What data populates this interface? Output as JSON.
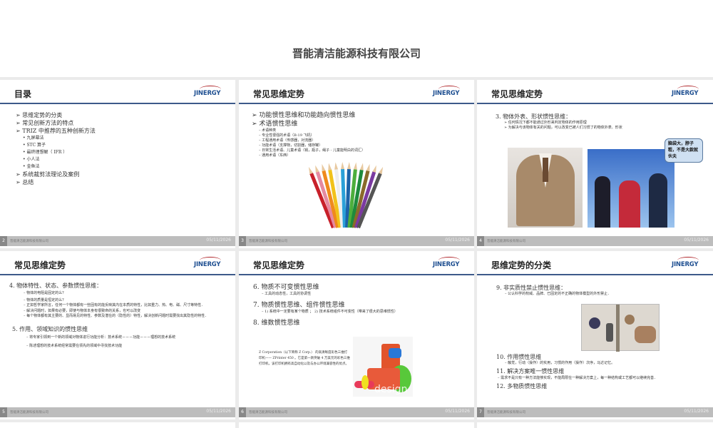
{
  "document_title": "晋能清洁能源科技有限公司",
  "logo_text": "JINERGY",
  "footer_company": "晋能清洁能源科技有限公司",
  "footer_date": "05/11/2026",
  "slides": [
    {
      "number": "2",
      "title": "目录",
      "items": [
        "➢ 思维定势的分类",
        "➢ 常见创新方法的特点",
        "➢ TRIZ 中推荐的五种创新方法"
      ],
      "subitems": [
        "•  九屏幕法",
        "•  STC 算子",
        "•  最终理想解（ IFR ）",
        "•  小人法",
        "•  金鱼法"
      ],
      "items2": [
        "➢ 系统裁剪法理论及案例",
        "➢ 总结"
      ]
    },
    {
      "number": "3",
      "title": "常见思维定势",
      "items": [
        "➢ 功能惯性思维和功能趋向惯性思维",
        "➢ 术语惯性思维"
      ],
      "subitems": [
        "–  术语种类",
        "–  专业性很强的术语（B-19 飞机）",
        "–  工程通用术语（传感器，对流器）",
        "–  功能术语（支撑物，切割器，储存罐）",
        "–  日常生活术语、儿童术语（锅，瓶子，绳子 - 儿童能明白的词汇）",
        "–  通用术语（东西）"
      ],
      "pencil_colors": [
        "#c8202a",
        "#e58aa0",
        "#ef8a1c",
        "#f1c21b",
        "#eeeeee",
        "#2aa0d8",
        "#1c62a8",
        "#4cae3c",
        "#1e8a3c",
        "#8a6a2a",
        "#7b3aa0",
        "#555555"
      ]
    },
    {
      "number": "4",
      "title": "常见思维定势",
      "heading": "3. 物体外表、形状惯性思维：",
      "subitems": [
        "➢ 任何情况下都不能通过外形来判定物体的作用原理",
        "➢ 为解决与该物体有关的问题，可以改变已被人们习惯了的物体外表、形状"
      ],
      "callout": "脑袋大，脖子粗，不是大款就伙夫"
    },
    {
      "number": "5",
      "title": "常见思维定势",
      "heading": "4. 物体特性、状态、参数惯性思维：",
      "subitems": [
        "–  物体的电阻是固定的么？",
        "–  物体的质量是恒定的么？",
        "–  正如哲学家所言，任何一个物体都有一些固有的能反映其内在本质的特性，比如重力、热、电、磁、尺寸等特性．",
        "–  解决问题时，如果有必要，即使与物体本身有很致命的关系，也可以改变",
        "–  每个物体都有其主要的、显而易见的特性、参数及潜在的（隐性的）特性，解决创新问题时需要找出其隐性的特性．"
      ],
      "heading2": "5. 作用、领域知识的惯性思维",
      "subitems2": [
        "–  将专家引领到一个新的领域对物体进行功能分析：技术系统－－－功能－－－理想的技术系统",
        "–  陈述理想的技术系统经常需要在领先的领域中寻找技术功能"
      ]
    },
    {
      "number": "6",
      "title": "常见思维定势",
      "h6": "6. 物质不可变惯性思维",
      "s6": "–  工具的动态性，工具的协调性",
      "h7": "7. 物质惯性思维、组件惯性思维",
      "s7": "–  1) 系统中一定要有某个物质 ； 2) 技术系统组件不可变性（带来了很大的思维惯性）",
      "h8": "8. 维数惯性思维",
      "para": "Z Corporation（以下简称 Z Corp.） 的高清晰度彩色三维打印机—— ZPrinter 450 。它是第一款突破 4 万美元的彩色三维打印机，该打印机拥有高自动化以及与办公环境兼容性的优点。",
      "image_text": "design"
    },
    {
      "number": "7",
      "title": "思维定势的分类",
      "h9": "9. 非实质性禁止惯性思维：",
      "s9": "–  公认科学的权威、品牌、已固定的不正确的物体模型的外形禁止．",
      "h10": "10. 作用惯性思维",
      "s10": "–  触觉，行动（操作）的实用，习惯的作用（操作）次序，马达记忆。",
      "h11": "11. 解决方案唯一惯性思维",
      "s11": "–  需求不是只有一种方法能够实现，不能局限在一种解决方案上，每一种结构或工艺都可以继续完善．",
      "h12": "12. 多物质惯性思维"
    }
  ]
}
